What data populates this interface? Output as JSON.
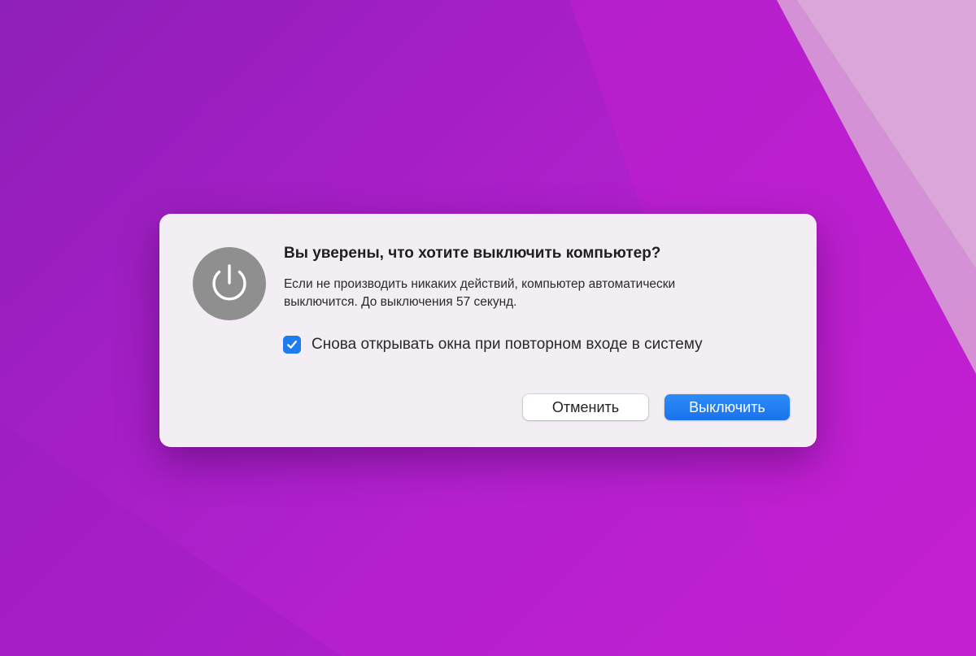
{
  "wallpaper": {
    "colors": [
      "#8e1fb8",
      "#b520cf",
      "#d97fd6"
    ]
  },
  "dialog": {
    "icon": "power-icon",
    "icon_color": "#8f8f8f",
    "title": "Вы уверены, что хотите выключить компьютер?",
    "message_line1": "Если не производить никаких действий, компьютер автоматически",
    "message_line2": "выключится. До выключения 57 секунд.",
    "checkbox": {
      "checked": true,
      "label": "Снова открывать окна при повторном входе в систему",
      "color": "#1f7cf0"
    },
    "buttons": {
      "cancel_label": "Отменить",
      "shutdown_label": "Выключить",
      "accent": "#1a72ec"
    }
  }
}
